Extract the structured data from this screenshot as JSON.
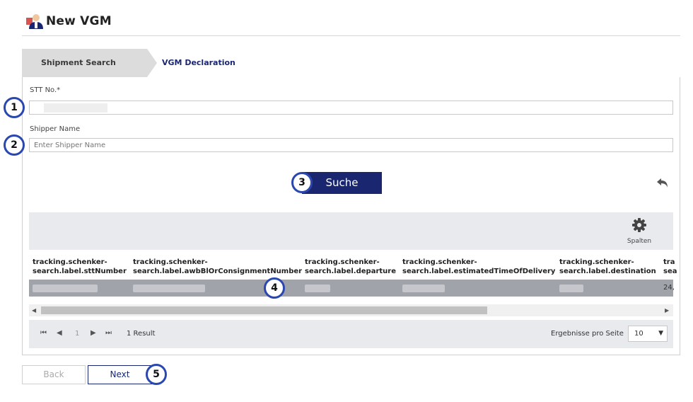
{
  "header": {
    "title": "New VGM",
    "icon": "person-icon"
  },
  "tabs": [
    {
      "label": "Shipment Search",
      "active": true
    },
    {
      "label": "VGM Declaration",
      "active": false
    }
  ],
  "form": {
    "stt_label": "STT No.*",
    "stt_value": "",
    "shipper_label": "Shipper Name",
    "shipper_placeholder": "Enter Shipper Name",
    "search_label": "Suche"
  },
  "grid": {
    "columns_label": "Spalten",
    "headers": [
      {
        "line1": "tracking.schenker-",
        "line2": "search.label.sttNumber"
      },
      {
        "line1": "tracking.schenker-",
        "line2": "search.label.awbBlOrConsignmentNumber"
      },
      {
        "line1": "tracking.schenker-",
        "line2": "search.label.departure"
      },
      {
        "line1": "tracking.schenker-",
        "line2": "search.label.estimatedTimeOfDelivery"
      },
      {
        "line1": "tracking.schenker-",
        "line2": "search.label.destination"
      },
      {
        "line1": "tra",
        "line2": "sea"
      }
    ],
    "row_tail": "24,"
  },
  "pager": {
    "page": "1",
    "result": "1 Result",
    "page_size_label": "Ergebnisse pro Seite",
    "page_size": "10"
  },
  "footer": {
    "back_label": "Back",
    "next_label": "Next"
  },
  "badges": [
    "1",
    "2",
    "3",
    "4",
    "5"
  ],
  "colors": {
    "brand": "#1a2770",
    "badge_ring": "#2a47b0"
  }
}
